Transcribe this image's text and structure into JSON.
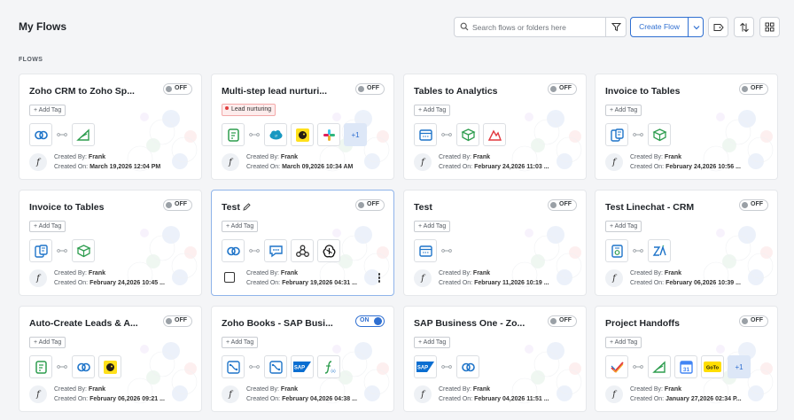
{
  "header": {
    "title": "My Flows",
    "search_placeholder": "Search flows or folders here",
    "create_label": "Create Flow"
  },
  "section_label": "FLOWS",
  "common": {
    "add_tag": "+ Add Tag",
    "created_by_label": "Created By:",
    "created_on_label": "Created On:",
    "owner_initial": "f"
  },
  "flows": [
    {
      "title": "Zoho CRM to Zoho Sp...",
      "status": "OFF",
      "enabled": false,
      "tag": null,
      "apps": [
        "zoho-crm",
        "zoho-sprints"
      ],
      "more": null,
      "created_by": "Frank",
      "created_on": "March 19,2026 12:04 PM"
    },
    {
      "title": "Multi-step lead nurturi...",
      "status": "OFF",
      "enabled": false,
      "tag": "Lead nurturing",
      "apps": [
        "zoho-forms",
        "salesforce",
        "mailchimp",
        "slack"
      ],
      "more": "+1",
      "created_by": "Frank",
      "created_on": "March 09,2026 10:34 AM"
    },
    {
      "title": "Tables to Analytics",
      "status": "OFF",
      "enabled": false,
      "tag": null,
      "apps": [
        "zoho-tables",
        "zoho-tables-green",
        "zoho-analytics"
      ],
      "more": null,
      "created_by": "Frank",
      "created_on": "February 24,2026 11:03 ..."
    },
    {
      "title": "Invoice to Tables",
      "status": "OFF",
      "enabled": false,
      "tag": null,
      "apps": [
        "zoho-invoice",
        "zoho-tables-green"
      ],
      "more": null,
      "created_by": "Frank",
      "created_on": "February 24,2026 10:56 ..."
    },
    {
      "title": "Invoice to Tables",
      "status": "OFF",
      "enabled": false,
      "tag": null,
      "apps": [
        "zoho-invoice",
        "zoho-tables-green"
      ],
      "more": null,
      "created_by": "Frank",
      "created_on": "February 24,2026 10:45 ..."
    },
    {
      "title": "Test",
      "status": "OFF",
      "enabled": false,
      "tag": null,
      "editable": true,
      "selected": true,
      "apps": [
        "zoho-crm",
        "zoho-cliq",
        "webhooks",
        "openai"
      ],
      "more": null,
      "created_by": "Frank",
      "created_on": "February 19,2026 04:31 ..."
    },
    {
      "title": "Test",
      "status": "OFF",
      "enabled": false,
      "tag": null,
      "apps": [
        "zoho-tables"
      ],
      "more": null,
      "created_by": "Frank",
      "created_on": "February 11,2026 10:19 ..."
    },
    {
      "title": "Test Linechat - CRM",
      "status": "OFF",
      "enabled": false,
      "tag": null,
      "apps": [
        "linechat",
        "zoho-crm-za"
      ],
      "more": null,
      "created_by": "Frank",
      "created_on": "February 06,2026 10:39 ..."
    },
    {
      "title": "Auto-Create Leads & A...",
      "status": "OFF",
      "enabled": false,
      "tag": null,
      "apps": [
        "zoho-forms",
        "zoho-crm",
        "mailchimp"
      ],
      "more": null,
      "created_by": "Frank",
      "created_on": "February 06,2026 09:21 ..."
    },
    {
      "title": "Zoho Books - SAP Busi...",
      "status": "ON",
      "enabled": true,
      "tag": null,
      "apps": [
        "zoho-books",
        "zoho-books",
        "sap",
        "zoho-formula"
      ],
      "more": null,
      "created_by": "Frank",
      "created_on": "February 04,2026 04:38 ..."
    },
    {
      "title": "SAP Business One - Zo...",
      "status": "OFF",
      "enabled": false,
      "tag": null,
      "apps": [
        "sap",
        "zoho-crm"
      ],
      "more": null,
      "created_by": "Frank",
      "created_on": "February 04,2026 11:51 ..."
    },
    {
      "title": "Project Handoffs",
      "status": "OFF",
      "enabled": false,
      "tag": null,
      "apps": [
        "zoho-projects",
        "zoho-sprints",
        "google-calendar",
        "gotodo"
      ],
      "more": "+1",
      "created_by": "Frank",
      "created_on": "January 27,2026 02:34 P..."
    }
  ],
  "icon_glyphs": {
    "sap_text": "SAP",
    "goto_text": "GoTo",
    "calendar_day": "31"
  }
}
